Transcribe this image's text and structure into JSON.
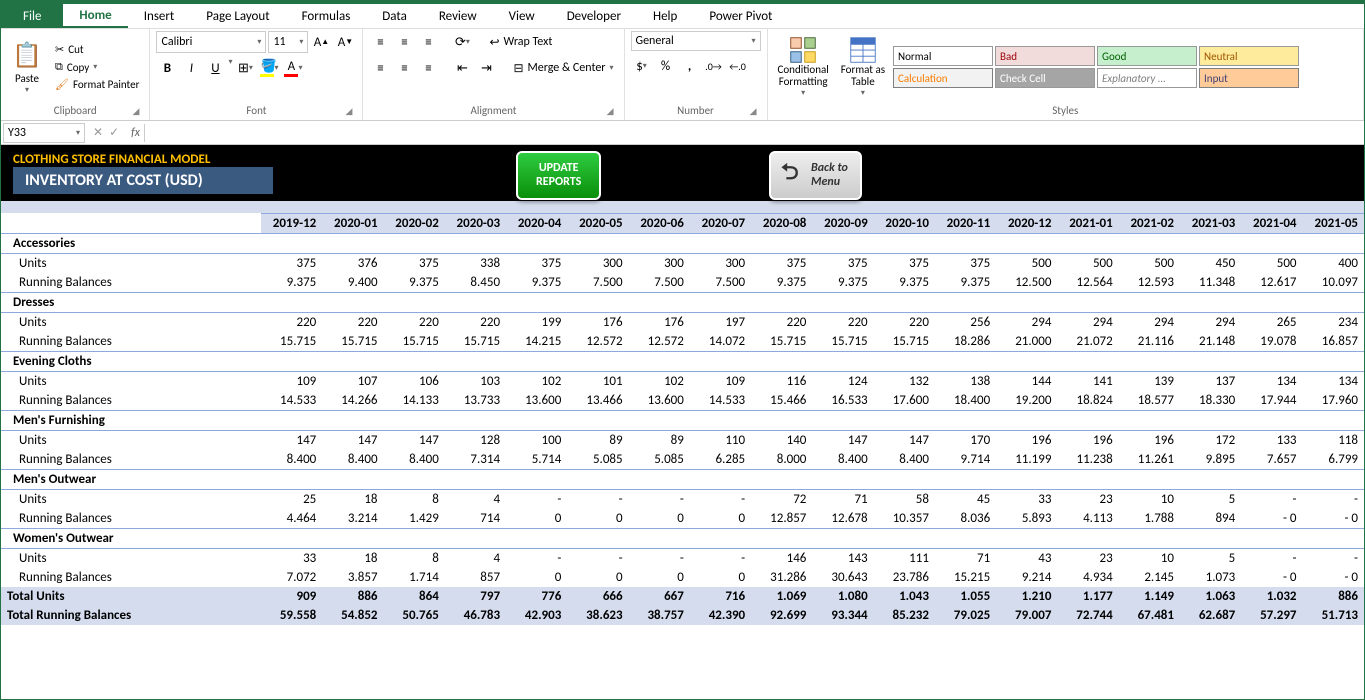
{
  "menu": {
    "file": "File",
    "home": "Home",
    "insert": "Insert",
    "pagelayout": "Page Layout",
    "formulas": "Formulas",
    "data": "Data",
    "review": "Review",
    "view": "View",
    "developer": "Developer",
    "help": "Help",
    "powerpivot": "Power Pivot"
  },
  "ribbon": {
    "clipboard": {
      "label": "Clipboard",
      "paste": "Paste",
      "cut": "Cut",
      "copy": "Copy",
      "painter": "Format Painter"
    },
    "font": {
      "label": "Font",
      "name": "Calibri",
      "size": "11",
      "bold": "B",
      "italic": "I",
      "underline": "U"
    },
    "alignment": {
      "label": "Alignment",
      "wrap": "Wrap Text",
      "merge": "Merge & Center"
    },
    "number": {
      "label": "Number",
      "format": "General"
    },
    "styles": {
      "label": "Styles",
      "conditional": "Conditional\nFormatting",
      "formatas": "Format as\nTable",
      "normal": "Normal",
      "bad": "Bad",
      "good": "Good",
      "neutral": "Neutral",
      "calculation": "Calculation",
      "checkcell": "Check Cell",
      "explanatory": "Explanatory ...",
      "input": "Input"
    }
  },
  "formulabar": {
    "namebox": "Y33",
    "fx": "fx"
  },
  "header": {
    "title": "CLOTHING STORE FINANCIAL MODEL",
    "subtitle": "INVENTORY AT COST (USD)",
    "update": "UPDATE\nREPORTS",
    "back": "Back to\nMenu"
  },
  "chart_data": {
    "type": "table",
    "columns": [
      "2019-12",
      "2020-01",
      "2020-02",
      "2020-03",
      "2020-04",
      "2020-05",
      "2020-06",
      "2020-07",
      "2020-08",
      "2020-09",
      "2020-10",
      "2020-11",
      "2020-12",
      "2021-01",
      "2021-02",
      "2021-03",
      "2021-04",
      "2021-05"
    ],
    "categories": [
      {
        "name": "Accessories",
        "rows": {
          "Units": [
            "375",
            "376",
            "375",
            "338",
            "375",
            "300",
            "300",
            "300",
            "375",
            "375",
            "375",
            "375",
            "500",
            "500",
            "500",
            "450",
            "500",
            "400"
          ],
          "Running Balances": [
            "9.375",
            "9.400",
            "9.375",
            "8.450",
            "9.375",
            "7.500",
            "7.500",
            "7.500",
            "9.375",
            "9.375",
            "9.375",
            "9.375",
            "12.500",
            "12.564",
            "12.593",
            "11.348",
            "12.617",
            "10.097"
          ]
        }
      },
      {
        "name": "Dresses",
        "rows": {
          "Units": [
            "220",
            "220",
            "220",
            "220",
            "199",
            "176",
            "176",
            "197",
            "220",
            "220",
            "220",
            "256",
            "294",
            "294",
            "294",
            "294",
            "265",
            "234"
          ],
          "Running Balances": [
            "15.715",
            "15.715",
            "15.715",
            "15.715",
            "14.215",
            "12.572",
            "12.572",
            "14.072",
            "15.715",
            "15.715",
            "15.715",
            "18.286",
            "21.000",
            "21.072",
            "21.116",
            "21.148",
            "19.078",
            "16.857"
          ]
        }
      },
      {
        "name": "Evening Cloths",
        "rows": {
          "Units": [
            "109",
            "107",
            "106",
            "103",
            "102",
            "101",
            "102",
            "109",
            "116",
            "124",
            "132",
            "138",
            "144",
            "141",
            "139",
            "137",
            "134",
            "134"
          ],
          "Running Balances": [
            "14.533",
            "14.266",
            "14.133",
            "13.733",
            "13.600",
            "13.466",
            "13.600",
            "14.533",
            "15.466",
            "16.533",
            "17.600",
            "18.400",
            "19.200",
            "18.824",
            "18.577",
            "18.330",
            "17.944",
            "17.960"
          ]
        }
      },
      {
        "name": "Men's Furnishing",
        "rows": {
          "Units": [
            "147",
            "147",
            "147",
            "128",
            "100",
            "89",
            "89",
            "110",
            "140",
            "147",
            "147",
            "170",
            "196",
            "196",
            "196",
            "172",
            "133",
            "118"
          ],
          "Running Balances": [
            "8.400",
            "8.400",
            "8.400",
            "7.314",
            "5.714",
            "5.085",
            "5.085",
            "6.285",
            "8.000",
            "8.400",
            "8.400",
            "9.714",
            "11.199",
            "11.238",
            "11.261",
            "9.895",
            "7.657",
            "6.799"
          ]
        }
      },
      {
        "name": "Men's Outwear",
        "rows": {
          "Units": [
            "25",
            "18",
            "8",
            "4",
            "-",
            "-",
            "-",
            "-",
            "72",
            "71",
            "58",
            "45",
            "33",
            "23",
            "10",
            "5",
            "-",
            "-"
          ],
          "Running Balances": [
            "4.464",
            "3.214",
            "1.429",
            "714",
            "0",
            "0",
            "0",
            "0",
            "12.857",
            "12.678",
            "10.357",
            "8.036",
            "5.893",
            "4.113",
            "1.788",
            "894",
            "- 0",
            "- 0"
          ]
        }
      },
      {
        "name": "Women's Outwear",
        "rows": {
          "Units": [
            "33",
            "18",
            "8",
            "4",
            "-",
            "-",
            "-",
            "-",
            "146",
            "143",
            "111",
            "71",
            "43",
            "23",
            "10",
            "5",
            "-",
            "-"
          ],
          "Running Balances": [
            "7.072",
            "3.857",
            "1.714",
            "857",
            "0",
            "0",
            "0",
            "0",
            "31.286",
            "30.643",
            "23.786",
            "15.215",
            "9.214",
            "4.934",
            "2.145",
            "1.073",
            "- 0",
            "- 0"
          ]
        }
      }
    ],
    "totals": {
      "Total Units": [
        "909",
        "886",
        "864",
        "797",
        "776",
        "666",
        "667",
        "716",
        "1.069",
        "1.080",
        "1.043",
        "1.055",
        "1.210",
        "1.177",
        "1.149",
        "1.063",
        "1.032",
        "886"
      ],
      "Total Running Balances": [
        "59.558",
        "54.852",
        "50.765",
        "46.783",
        "42.903",
        "38.623",
        "38.757",
        "42.390",
        "92.699",
        "93.344",
        "85.232",
        "79.025",
        "79.007",
        "72.744",
        "67.481",
        "62.687",
        "57.297",
        "51.713"
      ]
    }
  }
}
